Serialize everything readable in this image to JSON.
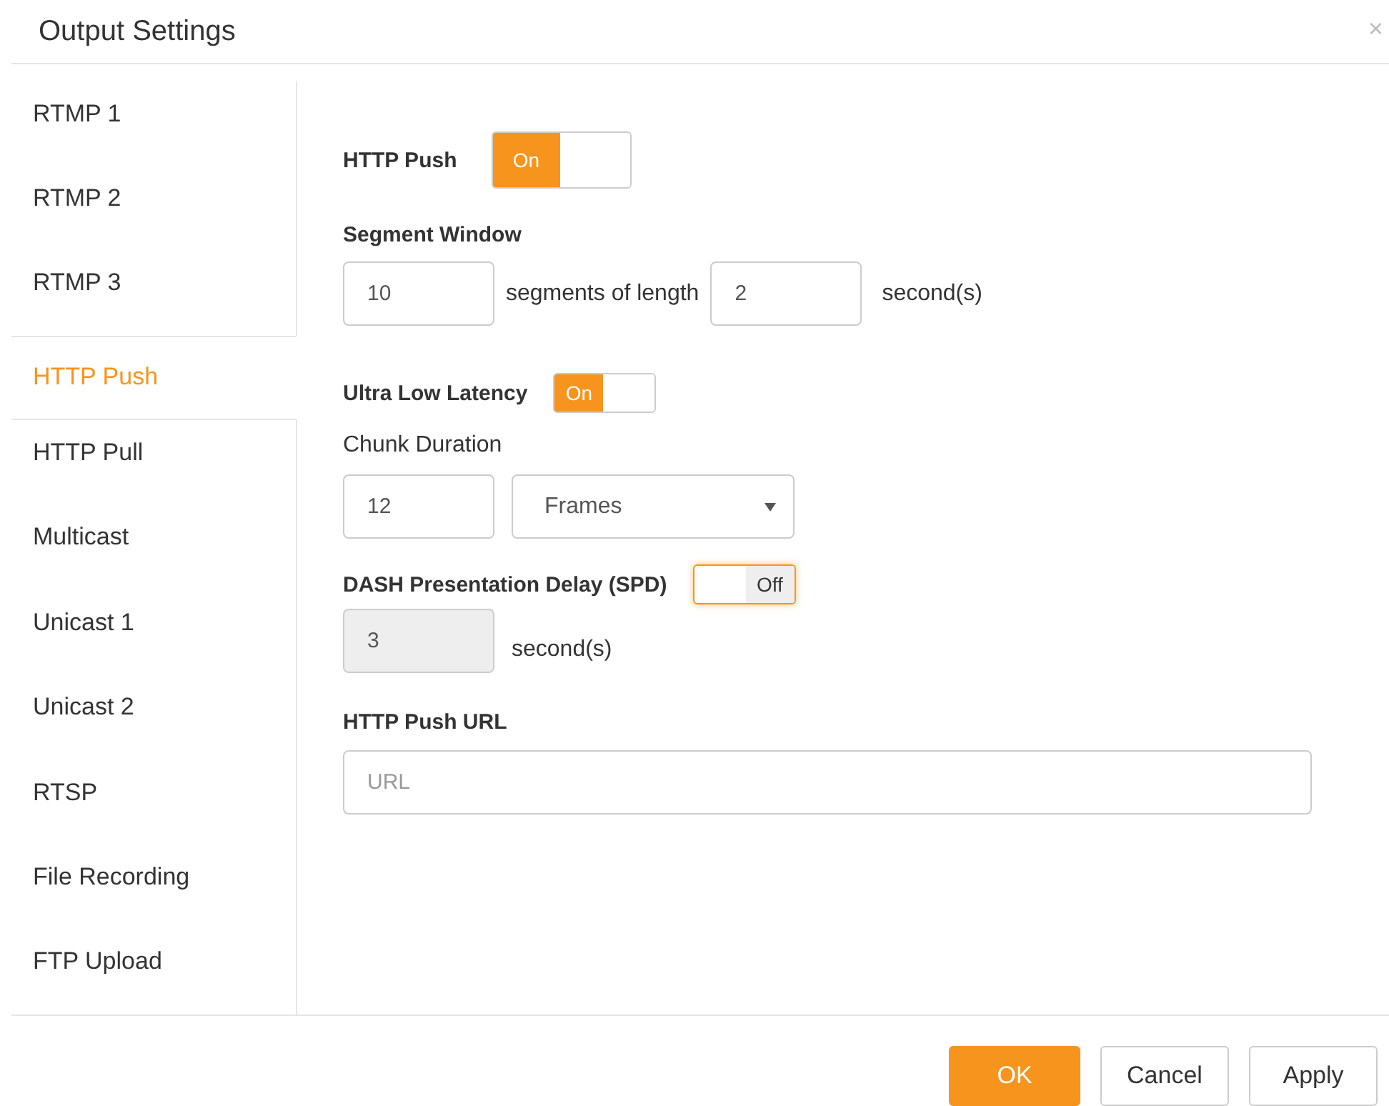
{
  "dialog": {
    "title": "Output Settings",
    "close": "×"
  },
  "sidebar": {
    "items": [
      {
        "label": "RTMP 1",
        "selected": false
      },
      {
        "label": "RTMP 2",
        "selected": false
      },
      {
        "label": "RTMP 3",
        "selected": false
      },
      {
        "label": "HTTP Push",
        "selected": true
      },
      {
        "label": "HTTP Pull",
        "selected": false
      },
      {
        "label": "Multicast",
        "selected": false
      },
      {
        "label": "Unicast 1",
        "selected": false
      },
      {
        "label": "Unicast 2",
        "selected": false
      },
      {
        "label": "RTSP",
        "selected": false
      },
      {
        "label": "File Recording",
        "selected": false
      },
      {
        "label": "FTP Upload",
        "selected": false
      }
    ]
  },
  "http_push": {
    "label": "HTTP Push",
    "toggle": {
      "on": true,
      "text": "On",
      "focused": false
    }
  },
  "segment_window": {
    "label": "Segment Window",
    "count": "10",
    "between": "segments of length",
    "length": "2",
    "unit": "second(s)"
  },
  "ultra_low_latency": {
    "label": "Ultra Low Latency",
    "toggle": {
      "on": true,
      "text": "On",
      "focused": false
    },
    "chunk_label": "Chunk Duration",
    "chunk_value": "12",
    "chunk_unit": "Frames"
  },
  "dash_delay": {
    "label": "DASH Presentation Delay (SPD)",
    "toggle": {
      "on": false,
      "text": "Off",
      "focused": true
    },
    "value": "3",
    "disabled": true,
    "unit": "second(s)"
  },
  "push_url": {
    "label": "HTTP Push URL",
    "placeholder": "URL"
  },
  "buttons": [
    {
      "label": "OK",
      "kind": "primary"
    },
    {
      "label": "Cancel",
      "kind": "default"
    },
    {
      "label": "Apply",
      "kind": "default"
    }
  ]
}
